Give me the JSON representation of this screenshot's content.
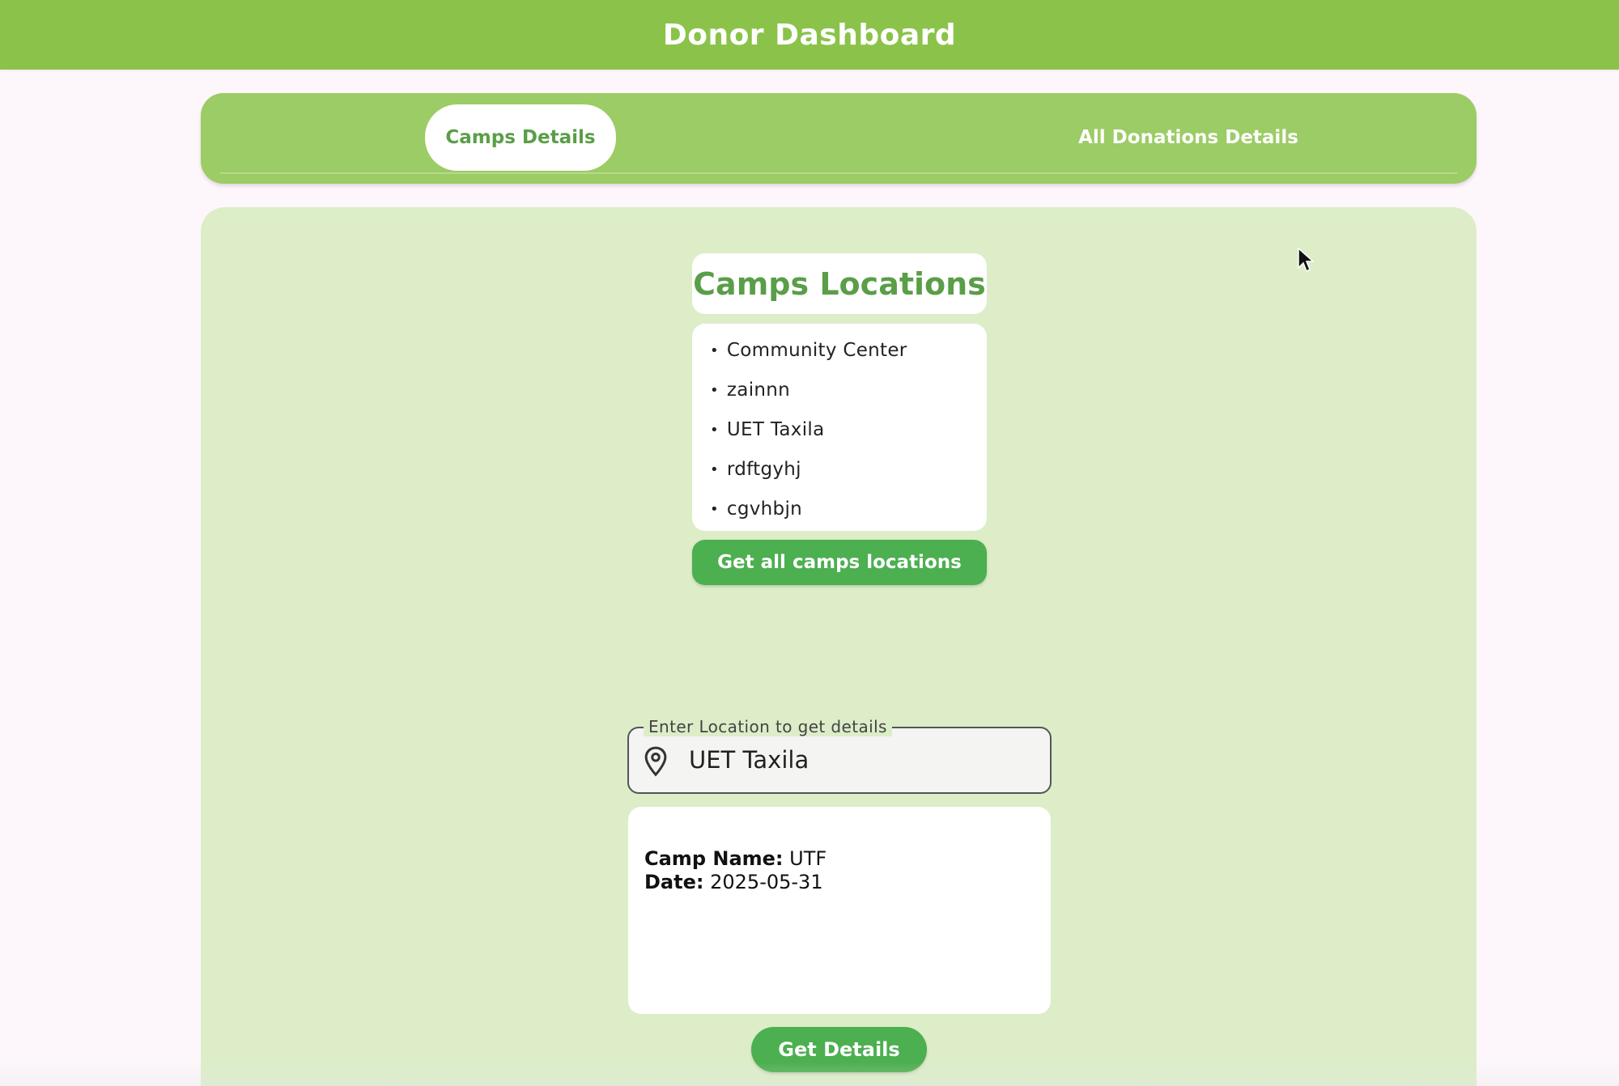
{
  "app": {
    "title": "Donor Dashboard"
  },
  "tabs": [
    {
      "label": "Camps Details",
      "active": true
    },
    {
      "label": "All Donations Details",
      "active": false
    }
  ],
  "locations": {
    "title": "Camps Locations",
    "items": [
      "Community Center",
      "zainnn",
      "UET Taxila",
      "rdftgyhj",
      "cgvhbjn"
    ],
    "button_label": "Get all camps locations"
  },
  "location_search": {
    "label": "Enter Location to get details",
    "value": "UET Taxila",
    "icon": "location-pin-icon"
  },
  "details": {
    "camp_name_label": "Camp Name:",
    "camp_name_value": "UTF",
    "date_label": "Date:",
    "date_value": "2025-05-31",
    "button_label": "Get Details"
  },
  "colors": {
    "app_bar": "#8bc34a",
    "tab_bar": "#9ccc65",
    "panel": "#dcedc8",
    "accent": "#4caf50",
    "title_text": "#5a9e48"
  }
}
